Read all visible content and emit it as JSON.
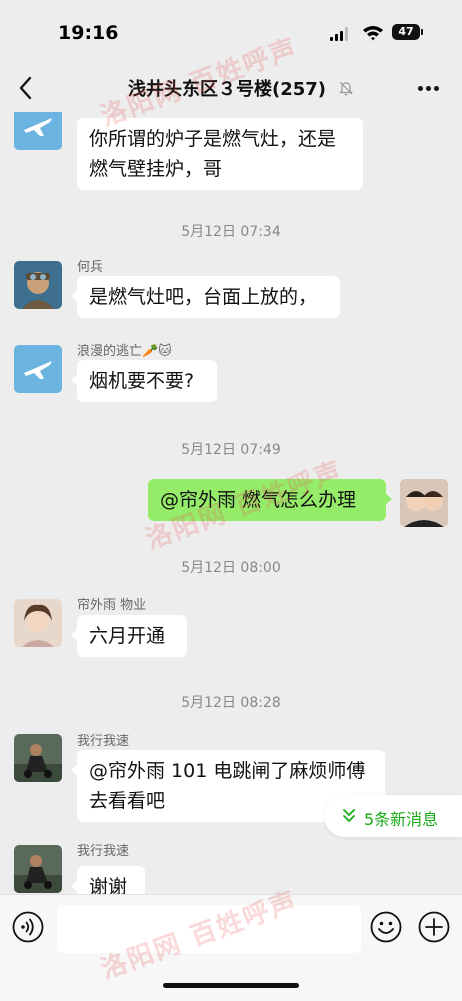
{
  "status_bar": {
    "time": "19:16",
    "battery": "47"
  },
  "header": {
    "title": "浅井头东区３号楼(257)"
  },
  "messages": [
    {
      "text": "你所谓的炉子是燃气灶，还是燃气壁挂炉，哥"
    },
    {
      "timestamp": "5月12日 07:34"
    },
    {
      "sender": "何兵",
      "text": "是燃气灶吧，台面上放的，"
    },
    {
      "sender": "浪漫的逃亡🥕🐱",
      "text": "烟机要不要?"
    },
    {
      "timestamp": "5月12日 07:49"
    },
    {
      "text": "@帘外雨 燃气怎么办理"
    },
    {
      "timestamp": "5月12日 08:00"
    },
    {
      "sender": "帘外雨 物业",
      "text": "六月开通"
    },
    {
      "timestamp": "5月12日 08:28"
    },
    {
      "sender": "我行我速",
      "text": "@帘外雨 101 电跳闸了麻烦师傅去看看吧"
    },
    {
      "sender": "我行我速",
      "text": "谢谢"
    }
  ],
  "new_messages_label": "5条新消息",
  "watermark_text": "洛阳网 百姓呼声",
  "icons": {
    "back": "chevron-left-icon",
    "mute": "bell-slash-icon",
    "more": "ellipsis-icon",
    "voice": "voice-icon",
    "emoji": "emoji-icon",
    "plus": "plus-icon",
    "new_messages": "double-chevron-down-icon"
  },
  "colors": {
    "background": "#ededed",
    "my_bubble": "#95ec69",
    "other_bubble": "#ffffff",
    "accent_green": "#1aad19",
    "timestamp_text": "#888888",
    "watermark": "#e65050"
  }
}
